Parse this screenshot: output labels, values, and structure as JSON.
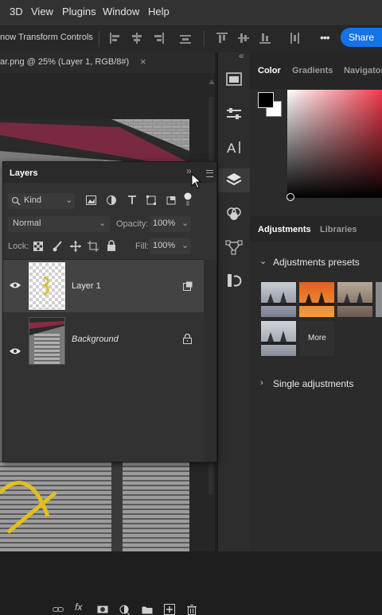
{
  "menubar": {
    "items": [
      "3D",
      "View",
      "Plugins",
      "Window",
      "Help"
    ]
  },
  "options": {
    "transform_label": "now Transform Controls",
    "more_label": "•••",
    "share_label": "Share"
  },
  "document": {
    "tab_title": "ar.png @ 25% (Layer 1, RGB/8#)",
    "close_glyph": "×"
  },
  "right_panel": {
    "collapse_glyph": "«",
    "tabs_top": [
      "Color",
      "Gradients",
      "Navigator"
    ],
    "tabs_mid": [
      "Adjustments",
      "Libraries"
    ],
    "presets_label": "Adjustments presets",
    "more_label": "More",
    "single_label": "Single adjustments"
  },
  "layers_panel": {
    "title": "Layers",
    "filter_kind": "Kind",
    "blend_mode": "Normal",
    "opacity_label": "Opacity:",
    "opacity_value": "100%",
    "lock_label": "Lock:",
    "fill_label": "Fill:",
    "fill_value": "100%",
    "layers": [
      {
        "name": "Layer 1"
      },
      {
        "name": "Background"
      }
    ],
    "footer_fx": "fx"
  },
  "colors": {
    "accent": "#1473e6",
    "panel": "#323232",
    "selected_row": "#434343"
  }
}
